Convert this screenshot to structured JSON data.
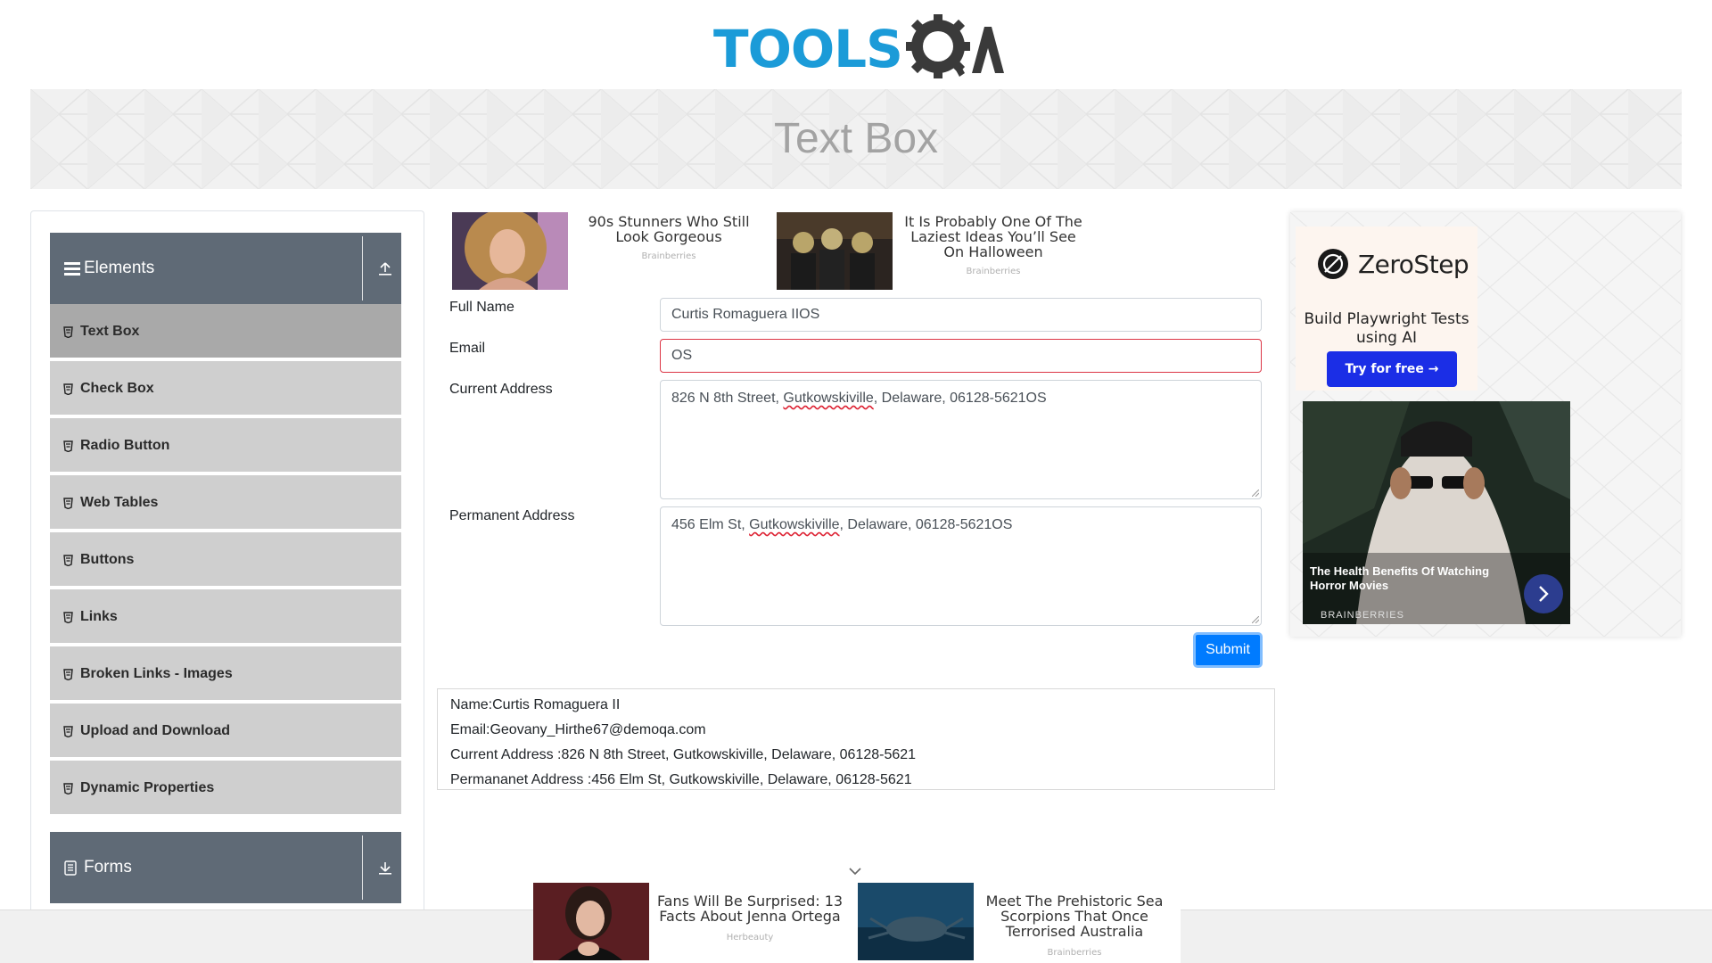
{
  "logo": {
    "text": "TOOLS",
    "qa": "QA"
  },
  "banner": {
    "title": "Text Box"
  },
  "sidebar": {
    "elements_group": {
      "label": "Elements"
    },
    "items": [
      {
        "label": "Text Box",
        "active": true
      },
      {
        "label": "Check Box"
      },
      {
        "label": "Radio Button"
      },
      {
        "label": "Web Tables"
      },
      {
        "label": "Buttons"
      },
      {
        "label": "Links"
      },
      {
        "label": "Broken Links - Images"
      },
      {
        "label": "Upload and Download"
      },
      {
        "label": "Dynamic Properties"
      }
    ],
    "forms_group": {
      "label": "Forms"
    }
  },
  "top_ads": [
    {
      "title": "90s Stunners Who Still Look Gorgeous",
      "source": "Brainberries"
    },
    {
      "title": "It Is Probably One Of The Laziest Ideas You’ll See On Halloween",
      "source": "Brainberries"
    }
  ],
  "form": {
    "full_name": {
      "label": "Full Name",
      "value": "Curtis Romaguera IIOS"
    },
    "email": {
      "label": "Email",
      "value": "OS"
    },
    "current_address": {
      "label": "Current Address",
      "value_pre": "826 N 8th Street, ",
      "value_misspelled": "Gutkowskiville",
      "value_post": ", Delaware, 06128-5621OS"
    },
    "permanent_address": {
      "label": "Permanent Address",
      "value_pre": "456 Elm St, ",
      "value_misspelled": "Gutkowskiville",
      "value_post": ", Delaware, 06128-5621OS"
    },
    "submit_label": "Submit"
  },
  "output": {
    "name": "Name:Curtis Romaguera II",
    "email": "Email:Geovany_Hirthe67@demoqa.com",
    "current_address": "Current Address :826 N 8th Street, Gutkowskiville, Delaware, 06128-5621",
    "permanent_address": "Permananet Address :456 Elm St, Gutkowskiville, Delaware, 06128-5621"
  },
  "right_ad": {
    "brand": "ZeroStep",
    "tagline": "Build Playwright Tests using AI",
    "cta": "Try for free →",
    "story_title": "The Health Benefits Of Watching Horror Movies",
    "story_source": "BRAINBERRIES"
  },
  "bottom_ads": [
    {
      "title": "Fans Will Be Surprised: 13 Facts About Jenna Ortega",
      "source": "Herbeauty"
    },
    {
      "title": "Meet The Prehistoric Sea Scorpions That Once Terrorised Australia",
      "source": "Brainberries"
    }
  ],
  "colors": {
    "logo_blue": "#1b9bd8",
    "logo_dark": "#3a3a3a",
    "sidebar_header": "#5f6a76",
    "menu_item": "#cfcfcf",
    "menu_item_active": "#a9a9a9",
    "submit": "#007bff",
    "error_border": "#dc3545",
    "cta_blue": "#1b2ee6"
  }
}
